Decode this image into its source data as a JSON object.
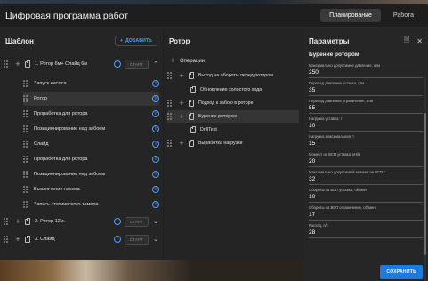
{
  "app": {
    "title": "Цифровая программа работ",
    "tabs": [
      "Планирование",
      "Работа"
    ]
  },
  "template": {
    "title": "Шаблон",
    "add_label": "ДОБАВИТЬ",
    "items": [
      {
        "label": "1. Ротор 6м+ Слайд 6м",
        "start": "СТАРТ",
        "chevron": "⌃"
      },
      {
        "label": "Запуск насоса"
      },
      {
        "label": "Ротор"
      },
      {
        "label": "Проработка для ротора"
      },
      {
        "label": "Позиционирование над забоем"
      },
      {
        "label": "Слайд"
      },
      {
        "label": "Проработка для ротора"
      },
      {
        "label": "Позиционирование над забоем"
      },
      {
        "label": "Выключение насоса"
      },
      {
        "label": "Запись статического замера"
      },
      {
        "label": "2. Ротор 12м.",
        "start": "СТАРТ",
        "chevron": "⌄"
      },
      {
        "label": "3. Слайд",
        "start": "СТАРТ",
        "chevron": "⌄"
      }
    ]
  },
  "rotor": {
    "title": "Ротор",
    "ops_label": "Операции",
    "items": [
      {
        "label": "Выход на обороты перед ротором"
      },
      {
        "label": "Обновление холостого хода"
      },
      {
        "label": "Подход к забою в роторе"
      },
      {
        "label": "Бурение ротором"
      },
      {
        "label": "DrillTest"
      },
      {
        "label": "Выработка нагрузки"
      }
    ]
  },
  "params": {
    "title": "Параметры",
    "subtitle": "Бурение ротором",
    "save_label": "СОХРАНИТЬ",
    "fields": [
      {
        "label": "Максимально допустимое давление, атм",
        "value": "250"
      },
      {
        "label": "Перепад давления уставка, атм",
        "value": "35"
      },
      {
        "label": "Перепад давления ограничение, атм",
        "value": "55"
      },
      {
        "label": "Нагрузка уставка, т",
        "value": "10"
      },
      {
        "label": "Нагрузка максимальная, т",
        "value": "15"
      },
      {
        "label": "Момент на ВСП уставка, кН/м",
        "value": "20"
      },
      {
        "label": "Максимально допустимый момент на ВСП с...",
        "value": "32"
      },
      {
        "label": "Обороты на ВСП уставка, об/мин",
        "value": "10"
      },
      {
        "label": "Обороты на ВСП ограничение, об/мин",
        "value": "17"
      },
      {
        "label": "Расход, л/с",
        "value": "28"
      }
    ]
  }
}
